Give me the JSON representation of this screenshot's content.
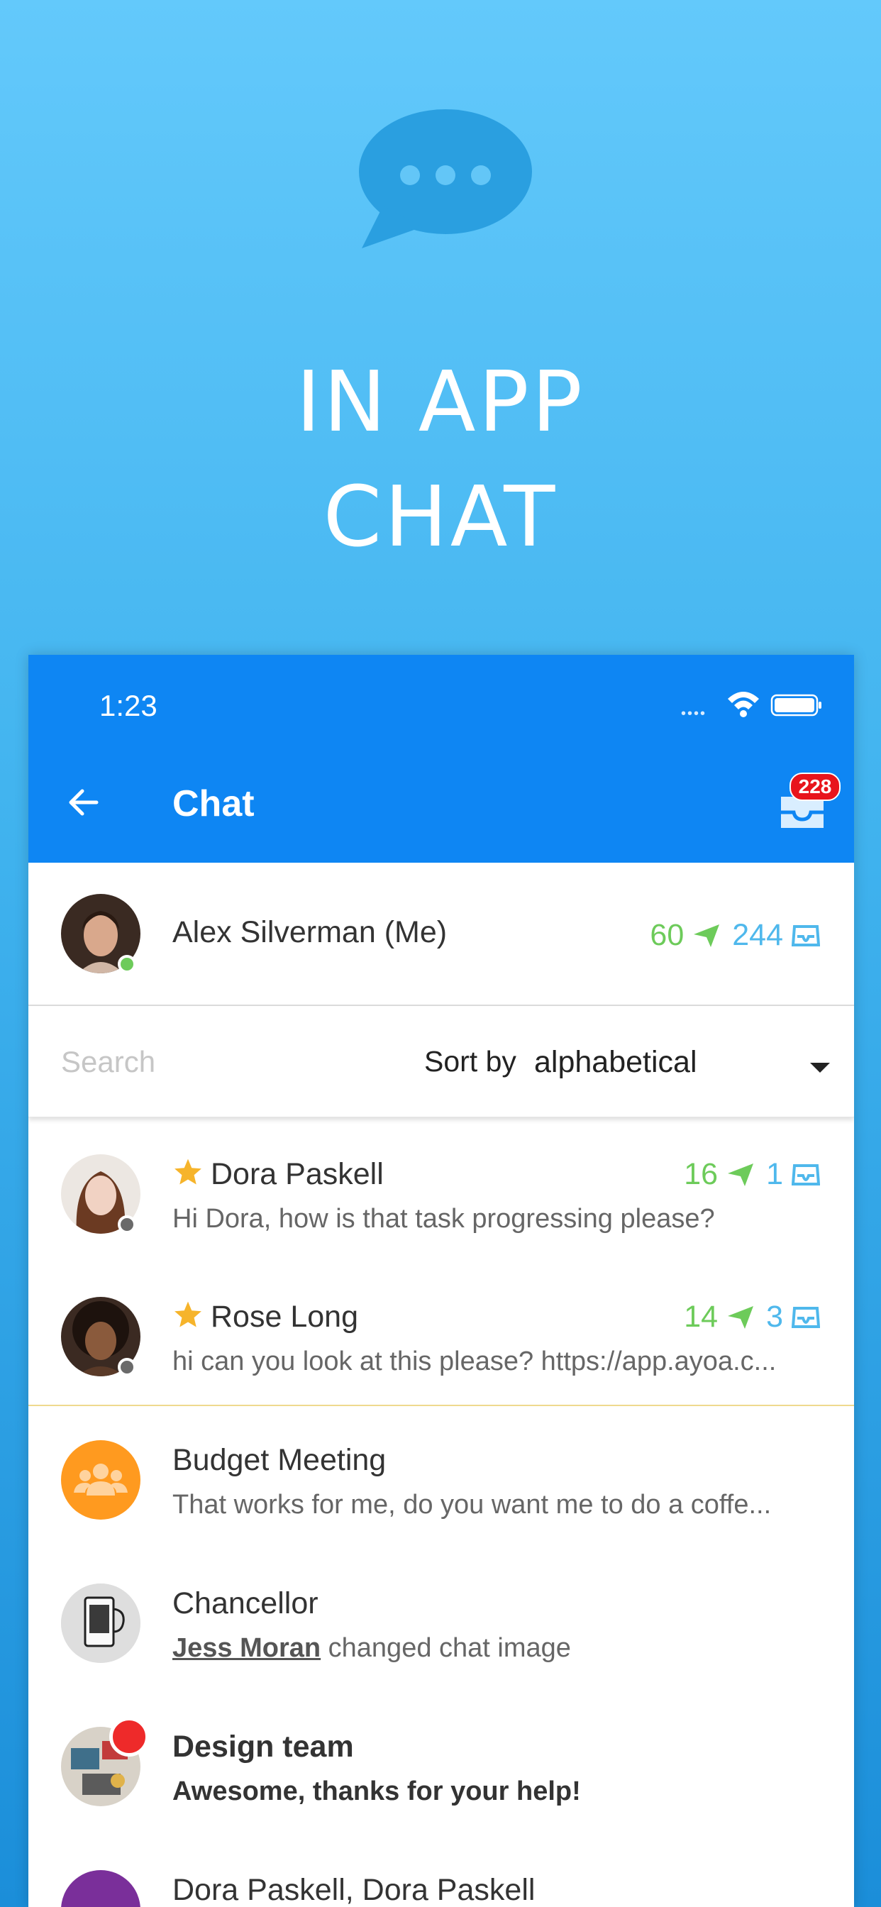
{
  "hero": {
    "icon": "chat-bubble-icon",
    "title_line1": "IN APP",
    "title_line2": "CHAT"
  },
  "status_bar": {
    "time": "1:23",
    "signal": "••••",
    "icons": [
      "wifi-icon",
      "battery-icon"
    ]
  },
  "header": {
    "title": "Chat",
    "inbox_badge": "228"
  },
  "me": {
    "name": "Alex Silverman (Me)",
    "sent": "60",
    "received": "244",
    "status": "online"
  },
  "search": {
    "placeholder": "Search",
    "sort_label": "Sort by",
    "sort_value": "alphabetical"
  },
  "chats": [
    {
      "name": "Dora Paskell",
      "starred": true,
      "sent": "16",
      "received": "1",
      "preview": "Hi Dora, how is that task progressing please?"
    },
    {
      "name": "Rose Long",
      "starred": true,
      "sent": "14",
      "received": "3",
      "preview": "hi can you look at this please? https://app.ayoa.c..."
    },
    {
      "name": "Budget Meeting",
      "preview": "That works for me, do you want me to do a coffe..."
    },
    {
      "name": "Chancellor",
      "preview_link": "Jess Moran",
      "preview": "changed chat image"
    },
    {
      "name": "Design team",
      "preview": "Awesome, thanks for your help!",
      "unread": true
    },
    {
      "name": "Dora Paskell, Dora Paskell"
    }
  ],
  "colors": {
    "appbar": "#0e86f3",
    "sent": "#6dcb5a",
    "received": "#4fb8ec",
    "star": "#f6b42b",
    "group": "#ff9a1f"
  }
}
